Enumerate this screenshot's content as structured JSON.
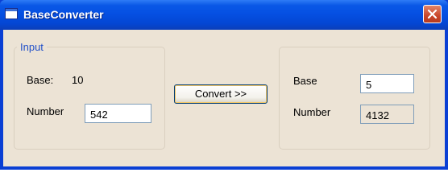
{
  "window": {
    "title": "BaseConverter",
    "close_icon": "close-icon"
  },
  "input_group": {
    "legend": "Input",
    "base_label": "Base:",
    "base_value": "10",
    "number_label": "Number",
    "number_value": "542"
  },
  "convert_button": {
    "label": "Convert >>"
  },
  "output_group": {
    "base_label": "Base",
    "base_value": "5",
    "number_label": "Number",
    "number_value": "4132"
  }
}
